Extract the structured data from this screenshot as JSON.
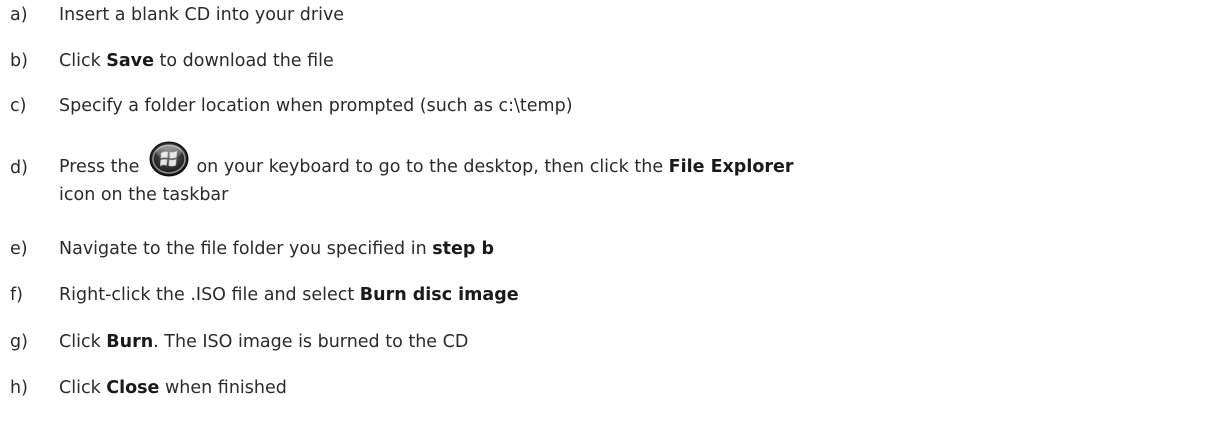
{
  "steps": [
    {
      "marker": "a)",
      "parts": {
        "t1": "Insert a blank CD into your drive"
      }
    },
    {
      "marker": "b)",
      "parts": {
        "t1": "Click ",
        "b1": "Save",
        "t2": " to download the file"
      }
    },
    {
      "marker": "c)",
      "parts": {
        "t1": "Specify a folder location when prompted (such as c:\\temp)"
      }
    },
    {
      "marker": "d)",
      "parts": {
        "t1": "Press the ",
        "b1": "Windows key",
        "t2": " on your keyboard to go to the desktop, then click the ",
        "b2": "File Explorer",
        "t3": "icon on the taskbar"
      }
    },
    {
      "marker": "e)",
      "parts": {
        "t1": "Navigate to the file folder you specified in ",
        "b1": "step b"
      }
    },
    {
      "marker": "f)",
      "parts": {
        "t1": "Right-click the .ISO file and select ",
        "b1": "Burn disc image"
      }
    },
    {
      "marker": "g)",
      "parts": {
        "t1": "Click ",
        "b1": "Burn",
        "t2": ". The ISO image is burned to the CD"
      }
    },
    {
      "marker": "h)",
      "parts": {
        "t1": "Click ",
        "b1": "Close",
        "t2": " when finished"
      }
    }
  ],
  "icons": {
    "windows_key": "windows-start-orb-icon"
  }
}
